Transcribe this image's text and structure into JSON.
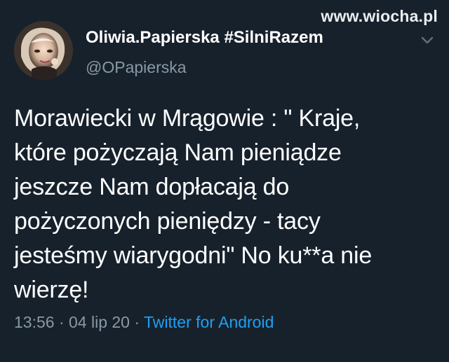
{
  "watermark": {
    "text": "www.wiocha.pl"
  },
  "author": {
    "display_name": "Oliwia.Papierska #SilniRazem",
    "handle": "@OPapierska"
  },
  "icons": {
    "avatar": "user-avatar",
    "menu": "chevron-down-icon"
  },
  "tweet": {
    "text": "Morawiecki w Mrągowie : \" Kraje,\nktóre pożyczają Nam pieniądze\njeszcze Nam dopłacają do\npożyczonych pieniędzy - tacy\njesteśmy wiarygodni\" No ku**a nie\nwierzę!",
    "time": "13:56",
    "date": "04 lip 20",
    "source": "Twitter for Android"
  },
  "colors": {
    "background": "#17212c",
    "text_primary": "#ffffff",
    "text_secondary": "#8899a6",
    "accent": "#1da1f2"
  }
}
